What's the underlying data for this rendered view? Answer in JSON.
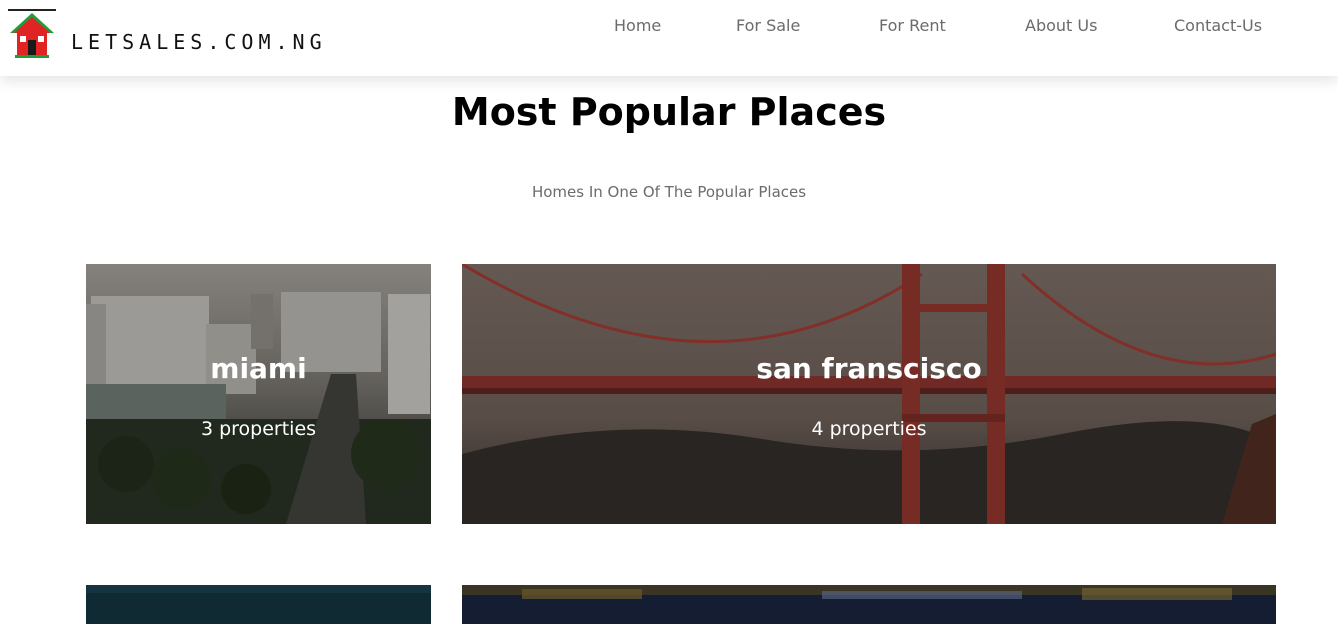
{
  "header": {
    "logo_text": "LETSALES.COM.NG",
    "nav": [
      {
        "label": "Home"
      },
      {
        "label": "For Sale"
      },
      {
        "label": "For Rent"
      },
      {
        "label": "About Us"
      },
      {
        "label": "Contact-Us"
      }
    ]
  },
  "section": {
    "title": "Most Popular Places",
    "subtitle": "Homes In One Of The Popular Places"
  },
  "places": [
    {
      "name": "miami",
      "count": "3 properties"
    },
    {
      "name": "san franscisco",
      "count": "4 properties"
    }
  ],
  "colors": {
    "brand_red": "#e02424",
    "brand_green": "#1f9d3a",
    "nav_text": "#6b6b6b"
  }
}
